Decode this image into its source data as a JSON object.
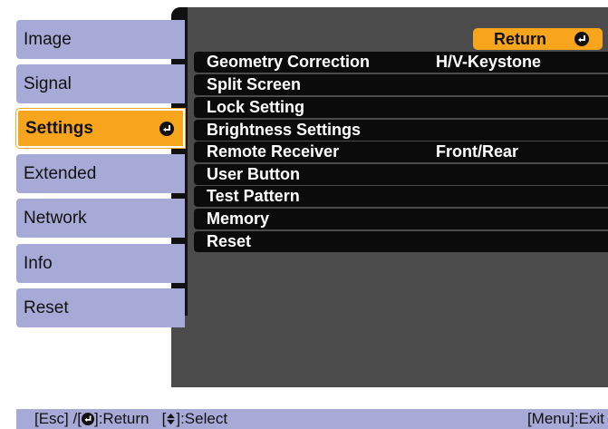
{
  "sidebar": {
    "items": [
      {
        "label": "Image"
      },
      {
        "label": "Signal"
      },
      {
        "label": "Settings"
      },
      {
        "label": "Extended"
      },
      {
        "label": "Network"
      },
      {
        "label": "Info"
      },
      {
        "label": "Reset"
      }
    ],
    "selected": "Settings"
  },
  "panel": {
    "return_label": "Return",
    "rows": [
      {
        "label": "Geometry Correction",
        "value": "H/V-Keystone"
      },
      {
        "label": "Split Screen",
        "value": ""
      },
      {
        "label": "Lock Setting",
        "value": ""
      },
      {
        "label": "Brightness Settings",
        "value": ""
      },
      {
        "label": "Remote Receiver",
        "value": "Front/Rear"
      },
      {
        "label": "User Button",
        "value": ""
      },
      {
        "label": "Test Pattern",
        "value": ""
      },
      {
        "label": "Memory",
        "value": ""
      },
      {
        "label": "Reset",
        "value": ""
      }
    ]
  },
  "status_bar": {
    "esc_text": "[Esc] /[",
    "return_text": "]:Return",
    "select_text": "[",
    "select_text2": "]:Select",
    "menu_exit": "[Menu]:Exit"
  },
  "colors": {
    "sidebar_bg": "#a7a9d6",
    "selected_bg": "#f7a51d",
    "panel_bg": "#4b4b4b",
    "row_bg": "#0b0b0b",
    "accent": "#f7a51d"
  },
  "icons": {
    "enter": "enter-arrow-icon",
    "updown": "up-down-arrow-icon"
  }
}
